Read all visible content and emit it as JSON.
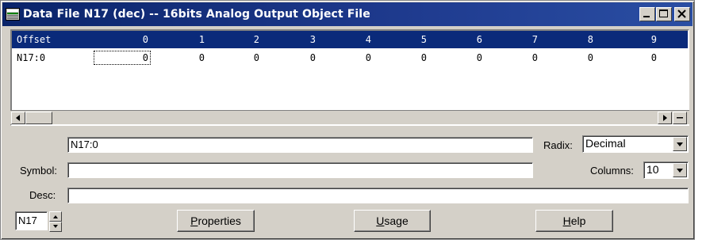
{
  "window": {
    "title": "Data File N17 (dec) -- 16bits Analog Output Object File",
    "controls": {
      "minimize": "minimize-icon",
      "maximize": "maximize-icon",
      "close": "close-icon"
    }
  },
  "grid": {
    "headers": [
      "Offset",
      "0",
      "1",
      "2",
      "3",
      "4",
      "5",
      "6",
      "7",
      "8",
      "9"
    ],
    "rows": [
      {
        "offset": "N17:0",
        "values": [
          "0",
          "0",
          "0",
          "0",
          "0",
          "0",
          "0",
          "0",
          "0",
          "0"
        ]
      }
    ],
    "selected_column": "0"
  },
  "address": {
    "value": "N17:0"
  },
  "radix": {
    "label": "Radix:",
    "selected": "Decimal"
  },
  "symbol": {
    "label": "Symbol:",
    "value": ""
  },
  "columns": {
    "label": "Columns:",
    "selected": "10"
  },
  "desc": {
    "label": "Desc:",
    "value": ""
  },
  "file_selector": {
    "value": "N17"
  },
  "buttons": {
    "properties": "Properties",
    "usage": "Usage",
    "help": "Help"
  },
  "colors": {
    "header_bg": "#0a2a7a",
    "titlebar": "#0a246a",
    "face": "#d4d0c8"
  }
}
